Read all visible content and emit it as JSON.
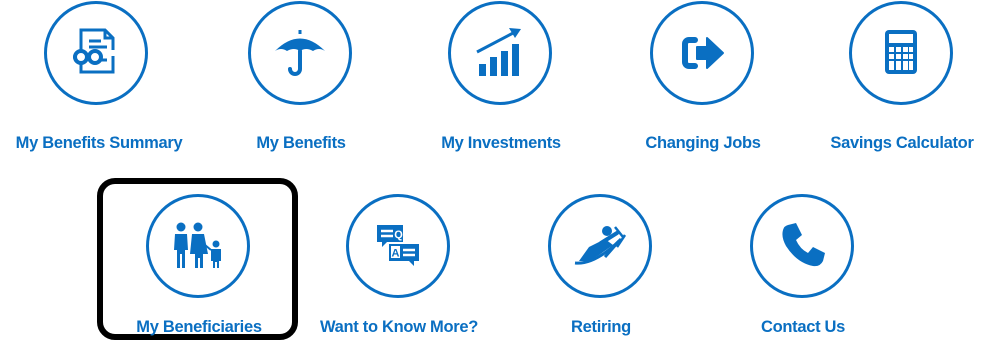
{
  "accent_color": "#0a6fc2",
  "tiles": [
    {
      "label": "My Benefits Summary",
      "icon": "document-glasses-icon"
    },
    {
      "label": "My Benefits",
      "icon": "umbrella-icon"
    },
    {
      "label": "My Investments",
      "icon": "growth-chart-icon"
    },
    {
      "label": "Changing Jobs",
      "icon": "exit-arrow-icon"
    },
    {
      "label": "Savings Calculator",
      "icon": "calculator-icon"
    },
    {
      "label": "My Beneficiaries",
      "icon": "family-icon",
      "selected": true
    },
    {
      "label": "Want to Know More?",
      "icon": "qa-chat-icon"
    },
    {
      "label": "Retiring",
      "icon": "lounge-chair-icon"
    },
    {
      "label": "Contact Us",
      "icon": "phone-icon"
    }
  ]
}
